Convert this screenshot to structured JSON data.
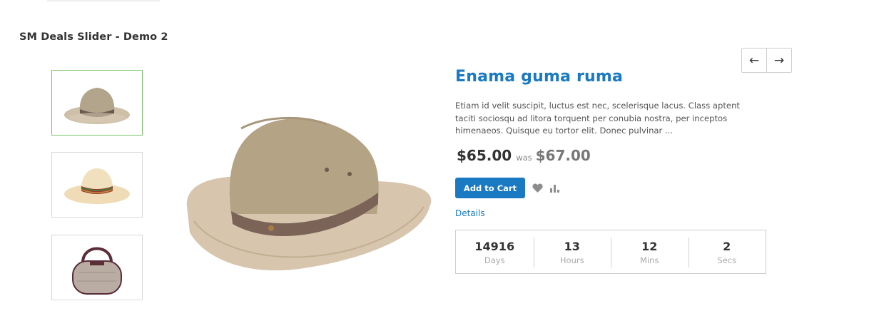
{
  "block": {
    "title": "SM Deals Slider - Demo 2"
  },
  "thumbnails": [
    {
      "icon": "fedora-hat-icon",
      "selected": true
    },
    {
      "icon": "straw-hat-icon",
      "selected": false
    },
    {
      "icon": "handbag-icon",
      "selected": false
    }
  ],
  "main_image": {
    "icon": "safari-hat-icon"
  },
  "navigation": {
    "prev_label": "←",
    "next_label": "→"
  },
  "product": {
    "name": "Enama guma ruma",
    "description": "Etiam id velit suscipit, luctus est nec, scelerisque lacus. Class aptent taciti sociosqu ad litora torquent per conubia nostra, per inceptos himenaeos. Quisque eu tortor elit. Donec pulvinar ...",
    "price": "$65.00",
    "was_label": "was",
    "old_price": "$67.00",
    "add_to_cart_label": "Add to Cart",
    "wishlist_icon": "heart-icon",
    "compare_icon": "bar-chart-icon",
    "details_label": "Details"
  },
  "countdown": [
    {
      "value": "14916",
      "label": "Days"
    },
    {
      "value": "13",
      "label": "Hours"
    },
    {
      "value": "12",
      "label": "Mins"
    },
    {
      "value": "2",
      "label": "Secs"
    }
  ],
  "colors": {
    "accent": "#1979c3",
    "thumb_selected_border": "#7ac36a",
    "border": "#cccccc"
  }
}
